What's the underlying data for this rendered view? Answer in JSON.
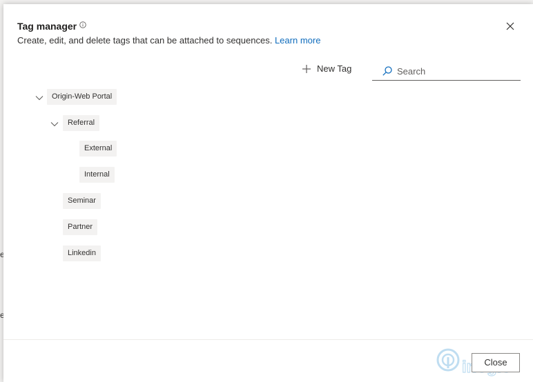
{
  "dialog": {
    "title": "Tag manager",
    "subtitle": "Create, edit, and delete tags that can be attached to sequences.",
    "learn_more": "Learn more",
    "close_icon": "close-icon",
    "info_icon": "info-icon"
  },
  "toolbar": {
    "new_tag_label": "New Tag",
    "new_tag_icon": "plus-icon",
    "search_placeholder": "Search",
    "search_icon": "search-icon"
  },
  "tree": {
    "tags": [
      {
        "label": "Origin-Web Portal",
        "level": 0,
        "expanded": true
      },
      {
        "label": "Referral",
        "level": 1,
        "expanded": true
      },
      {
        "label": "External",
        "level": 2
      },
      {
        "label": "Internal",
        "level": 2
      },
      {
        "label": "Seminar",
        "level": 1
      },
      {
        "label": "Partner",
        "level": 1
      },
      {
        "label": "Linkedin",
        "level": 1
      }
    ]
  },
  "footer": {
    "close_label": "Close"
  },
  "watermark": {
    "caption": "innovative logic"
  },
  "colors": {
    "accent_link": "#0f6cbd",
    "tag_background": "#f3f2f1",
    "text": "#323130"
  }
}
